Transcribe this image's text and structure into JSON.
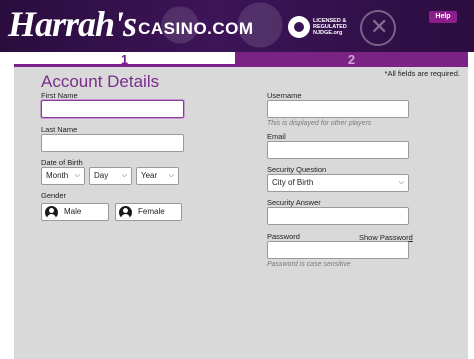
{
  "header": {
    "brand": "Harrah's",
    "brand_suffix": "CASINO.COM",
    "regulator_text": "LICENSED & REGULATED NJDGE.org",
    "help_label": "Help"
  },
  "steps": [
    {
      "label": "1",
      "active": true
    },
    {
      "label": "2",
      "active": false
    }
  ],
  "form": {
    "title": "Account Details",
    "required_note": "*All fields are required.",
    "first_name": {
      "label": "First Name",
      "value": ""
    },
    "last_name": {
      "label": "Last Name",
      "value": ""
    },
    "dob": {
      "label": "Date of Birth",
      "month": "Month",
      "day": "Day",
      "year": "Year"
    },
    "gender": {
      "label": "Gender",
      "options": [
        "Male",
        "Female"
      ]
    },
    "username": {
      "label": "Username",
      "hint": "This is displayed for other players",
      "value": ""
    },
    "email": {
      "label": "Email",
      "value": ""
    },
    "security_question": {
      "label": "Security Question",
      "selected": "City of Birth"
    },
    "security_answer": {
      "label": "Security Answer",
      "value": ""
    },
    "password": {
      "label": "Password",
      "show_link": "Show Password",
      "hint": "Password is case sensitive",
      "value": ""
    }
  },
  "colors": {
    "header_bg": "#3d1458",
    "accent": "#7a1f8c",
    "help_bg": "#8b1e8b",
    "panel_bg": "#d9d9d9"
  },
  "icons": {
    "male": "user-avatar-icon",
    "female": "user-avatar-icon",
    "dropdown": "chevron-down-icon"
  }
}
